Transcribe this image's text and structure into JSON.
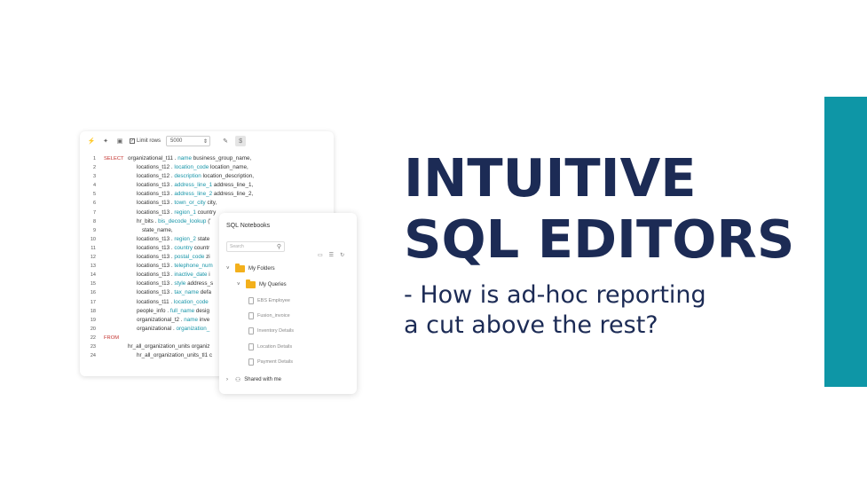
{
  "toolbar": {
    "limit_rows_label": "Limit rows",
    "limit_rows_value": "5000"
  },
  "editor": {
    "lines": [
      {
        "n": "1",
        "kw": "SELECT",
        "pre": "organizational_t11 .",
        "hl": "name",
        "post": "business_group_name,"
      },
      {
        "n": "2",
        "kw": "",
        "pre": "locations_t12 .",
        "hl": "location_code",
        "post": "location_name,"
      },
      {
        "n": "3",
        "kw": "",
        "pre": "locations_t12 .",
        "hl": "description",
        "post": "location_description,"
      },
      {
        "n": "4",
        "kw": "",
        "pre": "locations_t13 .",
        "hl": "address_line_1",
        "post": "address_line_1,"
      },
      {
        "n": "5",
        "kw": "",
        "pre": "locations_t13 .",
        "hl": "address_line_2",
        "post": "address_line_2,"
      },
      {
        "n": "6",
        "kw": "",
        "pre": "locations_t13 .",
        "hl": "town_or_city",
        "post": "city,"
      },
      {
        "n": "7",
        "kw": "",
        "pre": "locations_t13 .",
        "hl": "region_1",
        "post": "country"
      },
      {
        "n": "8",
        "kw": "",
        "pre": "hr_bits .",
        "hl": "bis_decode_lookup",
        "post": "('"
      },
      {
        "n": "9",
        "kw": "",
        "pre": "state_name,",
        "hl": "",
        "post": ""
      },
      {
        "n": "10",
        "kw": "",
        "pre": "locations_t13 .",
        "hl": "region_2",
        "post": "state"
      },
      {
        "n": "11",
        "kw": "",
        "pre": "locations_t13 .",
        "hl": "country",
        "post": "countr"
      },
      {
        "n": "12",
        "kw": "",
        "pre": "locations_t13 .",
        "hl": "postal_code",
        "post": "zi"
      },
      {
        "n": "13",
        "kw": "",
        "pre": "locations_t13 .",
        "hl": "telephone_num",
        "post": ""
      },
      {
        "n": "14",
        "kw": "",
        "pre": "locations_t13 .",
        "hl": "inactive_date",
        "post": "i"
      },
      {
        "n": "15",
        "kw": "",
        "pre": "locations_t13 .",
        "hl": "style",
        "post": "address_s"
      },
      {
        "n": "16",
        "kw": "",
        "pre": "locations_t13 .",
        "hl": "tax_name",
        "post": "defa"
      },
      {
        "n": "17",
        "kw": "",
        "pre": "locations_t11 .",
        "hl": "location_code",
        "post": ""
      },
      {
        "n": "18",
        "kw": "",
        "pre": "people_info .",
        "hl": "full_name",
        "post": "desig"
      },
      {
        "n": "19",
        "kw": "",
        "pre": "organizational_t2 .",
        "hl": "name",
        "post": "inve"
      },
      {
        "n": "20",
        "kw": "",
        "pre": "organizational .",
        "hl": "organization_",
        "post": ""
      },
      {
        "n": "22",
        "kw": "FROM",
        "pre": "",
        "hl": "",
        "post": ""
      },
      {
        "n": "23",
        "kw": "",
        "pre": "hr_all_organization_units organiz",
        "hl": "",
        "post": ""
      },
      {
        "n": "24",
        "kw": "",
        "pre": "hr_all_organization_units_tl1 c",
        "hl": "",
        "post": ""
      }
    ]
  },
  "notebooks": {
    "title": "SQL Notebooks",
    "search_placeholder": "Search",
    "my_folders": "My Folders",
    "my_queries": "My Queries",
    "files": [
      "EBS Employee",
      "Fusion_invoice",
      "Inventory Details",
      "Location Details",
      "Payment Details"
    ],
    "shared": "Shared with me"
  },
  "headline": {
    "line1": "INTUITIVE",
    "line2": "SQL EDITORS",
    "sub1": "- How is ad-hoc reporting",
    "sub2": "a cut above the rest?"
  },
  "colors": {
    "accent_bar": "#0e96a6",
    "headline": "#1c2b55",
    "keyword": "#c4332f",
    "identifier": "#1795a8"
  }
}
